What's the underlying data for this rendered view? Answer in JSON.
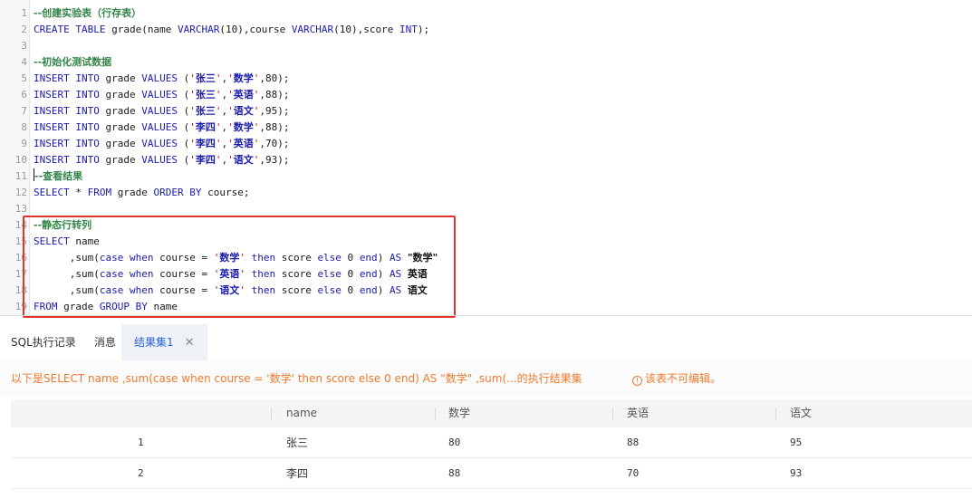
{
  "editor": {
    "line_numbers": [
      "1",
      "2",
      "3",
      "4",
      "5",
      "6",
      "7",
      "8",
      "9",
      "10",
      "11",
      "12",
      "13",
      "14",
      "15",
      "16",
      "17",
      "18",
      "19"
    ],
    "l1_comment": "--创建实验表（行存表）",
    "l2": {
      "create_table": "CREATE TABLE",
      "rest1": " grade(name ",
      "varchar1": "VARCHAR",
      "len1": "(10)",
      "rest2": ",course ",
      "varchar2": "VARCHAR",
      "len2": "(10)",
      "rest3": ",score ",
      "int": "INT",
      "end": ");"
    },
    "l4_comment": "--初始化测试数据",
    "inserts": [
      {
        "name": "张三",
        "course": "数学",
        "score": "80"
      },
      {
        "name": "张三",
        "course": "英语",
        "score": "88"
      },
      {
        "name": "张三",
        "course": "语文",
        "score": "95"
      },
      {
        "name": "李四",
        "course": "数学",
        "score": "88"
      },
      {
        "name": "李四",
        "course": "英语",
        "score": "70"
      },
      {
        "name": "李四",
        "course": "语文",
        "score": "93"
      }
    ],
    "insert_kw": "INSERT INTO",
    "insert_table": " grade ",
    "values_kw": "VALUES",
    "l11_comment": "--查看结果",
    "l12": {
      "select": "SELECT",
      "star": " * ",
      "from": "FROM",
      "table": " grade ",
      "order": "ORDER BY",
      "col": " course;"
    },
    "l14_comment": "--静态行转列",
    "l15": {
      "select": "SELECT",
      "col": " name"
    },
    "pivot_lines": [
      {
        "course": "数学",
        "alias": "\"数学\""
      },
      {
        "course": "英语",
        "alias": "英语"
      },
      {
        "course": "语文",
        "alias": "语文"
      }
    ],
    "l19": {
      "from": "FROM",
      "table": " grade ",
      "group": "GROUP BY",
      "col": " name"
    }
  },
  "panel": {
    "tabs": [
      {
        "label": "SQL执行记录"
      },
      {
        "label": "消息"
      },
      {
        "label": "结果集1"
      }
    ],
    "close_glyph": "✕",
    "notice": "以下是SELECT name ,sum(case when course = '数学' then score else 0 end) AS \"数学\" ,sum(...的执行结果集",
    "readonly_icon": "!",
    "readonly": "该表不可编辑。"
  },
  "result": {
    "columns": [
      "",
      "name",
      "数学",
      "英语",
      "语文"
    ],
    "rows": [
      [
        "1",
        "张三",
        "80",
        "88",
        "95"
      ],
      [
        "2",
        "李四",
        "88",
        "70",
        "93"
      ]
    ]
  }
}
